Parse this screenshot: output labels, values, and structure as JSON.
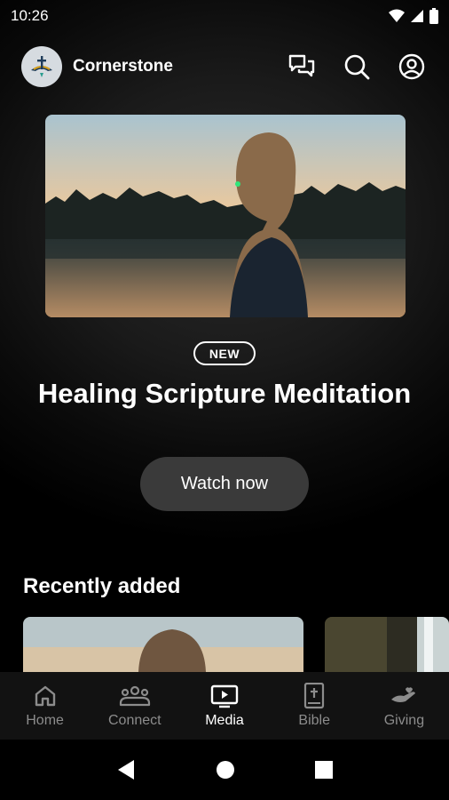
{
  "status_bar": {
    "time": "10:26"
  },
  "app": {
    "title": "Cornerstone"
  },
  "hero": {
    "badge": "NEW",
    "title": "Healing Scripture Meditation",
    "button_label": "Watch now"
  },
  "recent": {
    "title": "Recently added"
  },
  "nav": {
    "items": [
      {
        "label": "Home",
        "icon": "home-icon"
      },
      {
        "label": "Connect",
        "icon": "people-icon"
      },
      {
        "label": "Media",
        "icon": "tv-play-icon"
      },
      {
        "label": "Bible",
        "icon": "bible-icon"
      },
      {
        "label": "Giving",
        "icon": "hand-heart-icon"
      }
    ],
    "active": "Media"
  },
  "colors": {
    "background": "#000000",
    "button": "#3a3a3a",
    "nav_inactive": "#8c8c8c",
    "nav_active": "#ffffff"
  }
}
